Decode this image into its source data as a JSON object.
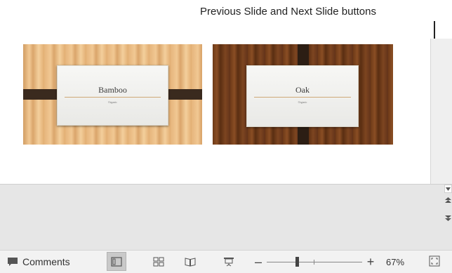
{
  "callout": {
    "text": "Previous Slide and Next Slide buttons"
  },
  "slides": [
    {
      "name": "Bamboo",
      "subtitle": "Organic"
    },
    {
      "name": "Oak",
      "subtitle": "Organic"
    }
  ],
  "statusbar": {
    "comments_label": "Comments",
    "zoom_level": "67%",
    "zoom_minus": "–",
    "zoom_plus": "+"
  },
  "colors": {
    "statusbar_bg": "#f2f2f2",
    "pane_gray": "#e6e6e6",
    "active_view": "#c9c9c9"
  }
}
